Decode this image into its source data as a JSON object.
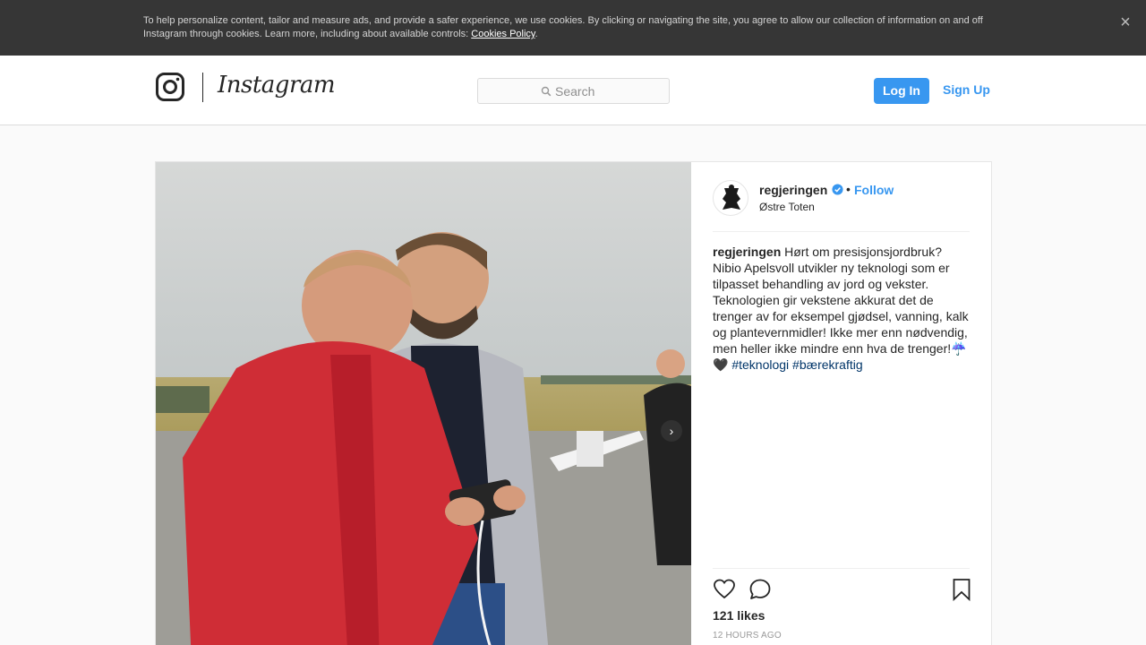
{
  "cookie_banner": {
    "text": "To help personalize content, tailor and measure ads, and provide a safer experience, we use cookies. By clicking or navigating the site, you agree to allow our collection of information on and off Instagram through cookies. Learn more, including about available controls: ",
    "link_label": "Cookies Policy",
    "suffix": ".",
    "close_label": "×"
  },
  "nav": {
    "wordmark": "Instagram",
    "search_placeholder": "Search",
    "login_label": "Log In",
    "signup_label": "Sign Up"
  },
  "post": {
    "username": "regjeringen",
    "follow_label": "Follow",
    "separator": "•",
    "location": "Østre Toten",
    "caption_user": "regjeringen",
    "caption_text": " Hørt om presisjonsjordbruk? Nibio Apelsvoll utvikler ny teknologi som er tilpasset behandling av jord og vekster. Teknologien gir vekstene akkurat det de trenger av for eksempel gjødsel, vanning, kalk og plantevernmidler! Ikke mer enn nødvendig, men heller ikke mindre enn hva de trenger!☔️🖤 ",
    "hashtags": [
      "#teknologi",
      "#bærekraftig"
    ],
    "likes": "121 likes",
    "time": "12 HOURS AGO",
    "carousel_next": "›"
  },
  "icons": {
    "logo": "instagram-camera-icon",
    "search": "search-icon",
    "verified": "verified-badge-icon",
    "like": "heart-icon",
    "comment": "comment-icon",
    "save": "bookmark-icon",
    "close": "close-icon"
  },
  "colors": {
    "accent": "#3897f0",
    "hashtag": "#003569",
    "banner_bg": "#363636"
  }
}
